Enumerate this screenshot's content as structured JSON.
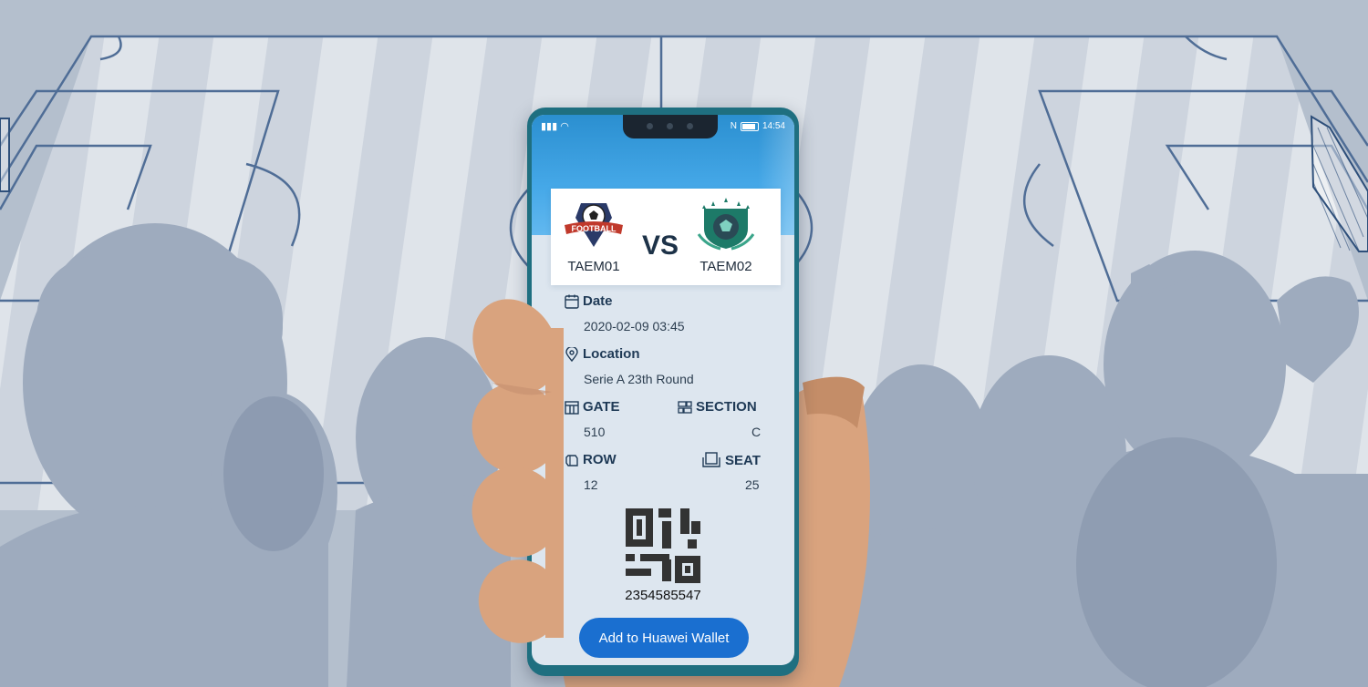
{
  "ticket": {
    "team1": "TAEM01",
    "vs": "VS",
    "team2": "TAEM02",
    "date_label": "Date",
    "date_value": "2020-02-09 03:45",
    "location_label": "Location",
    "location_value": "Serie A  23th Round",
    "gate_label": "GATE",
    "gate_value": "510",
    "section_label": "SECTION",
    "section_value": "C",
    "row_label": "ROW",
    "row_value": "12",
    "seat_label": "SEAT",
    "seat_value": "25",
    "ticket_number": "2354585547",
    "wallet_button": "Add to Huawei Wallet"
  },
  "badge_text": "FOOTBALL",
  "status_bar": {
    "time": "14:54"
  },
  "colors": {
    "button": "#1a6fd0",
    "screen_header": "#45a8e8",
    "phone_frame": "#1f6f80",
    "label": "#1f3a56"
  },
  "icons": {
    "date": "calendar-icon",
    "location": "location-pin-icon",
    "gate": "gate-icon",
    "section": "section-grid-icon",
    "row": "row-icon",
    "seat": "seat-icon",
    "qr": "qr-code-icon"
  }
}
